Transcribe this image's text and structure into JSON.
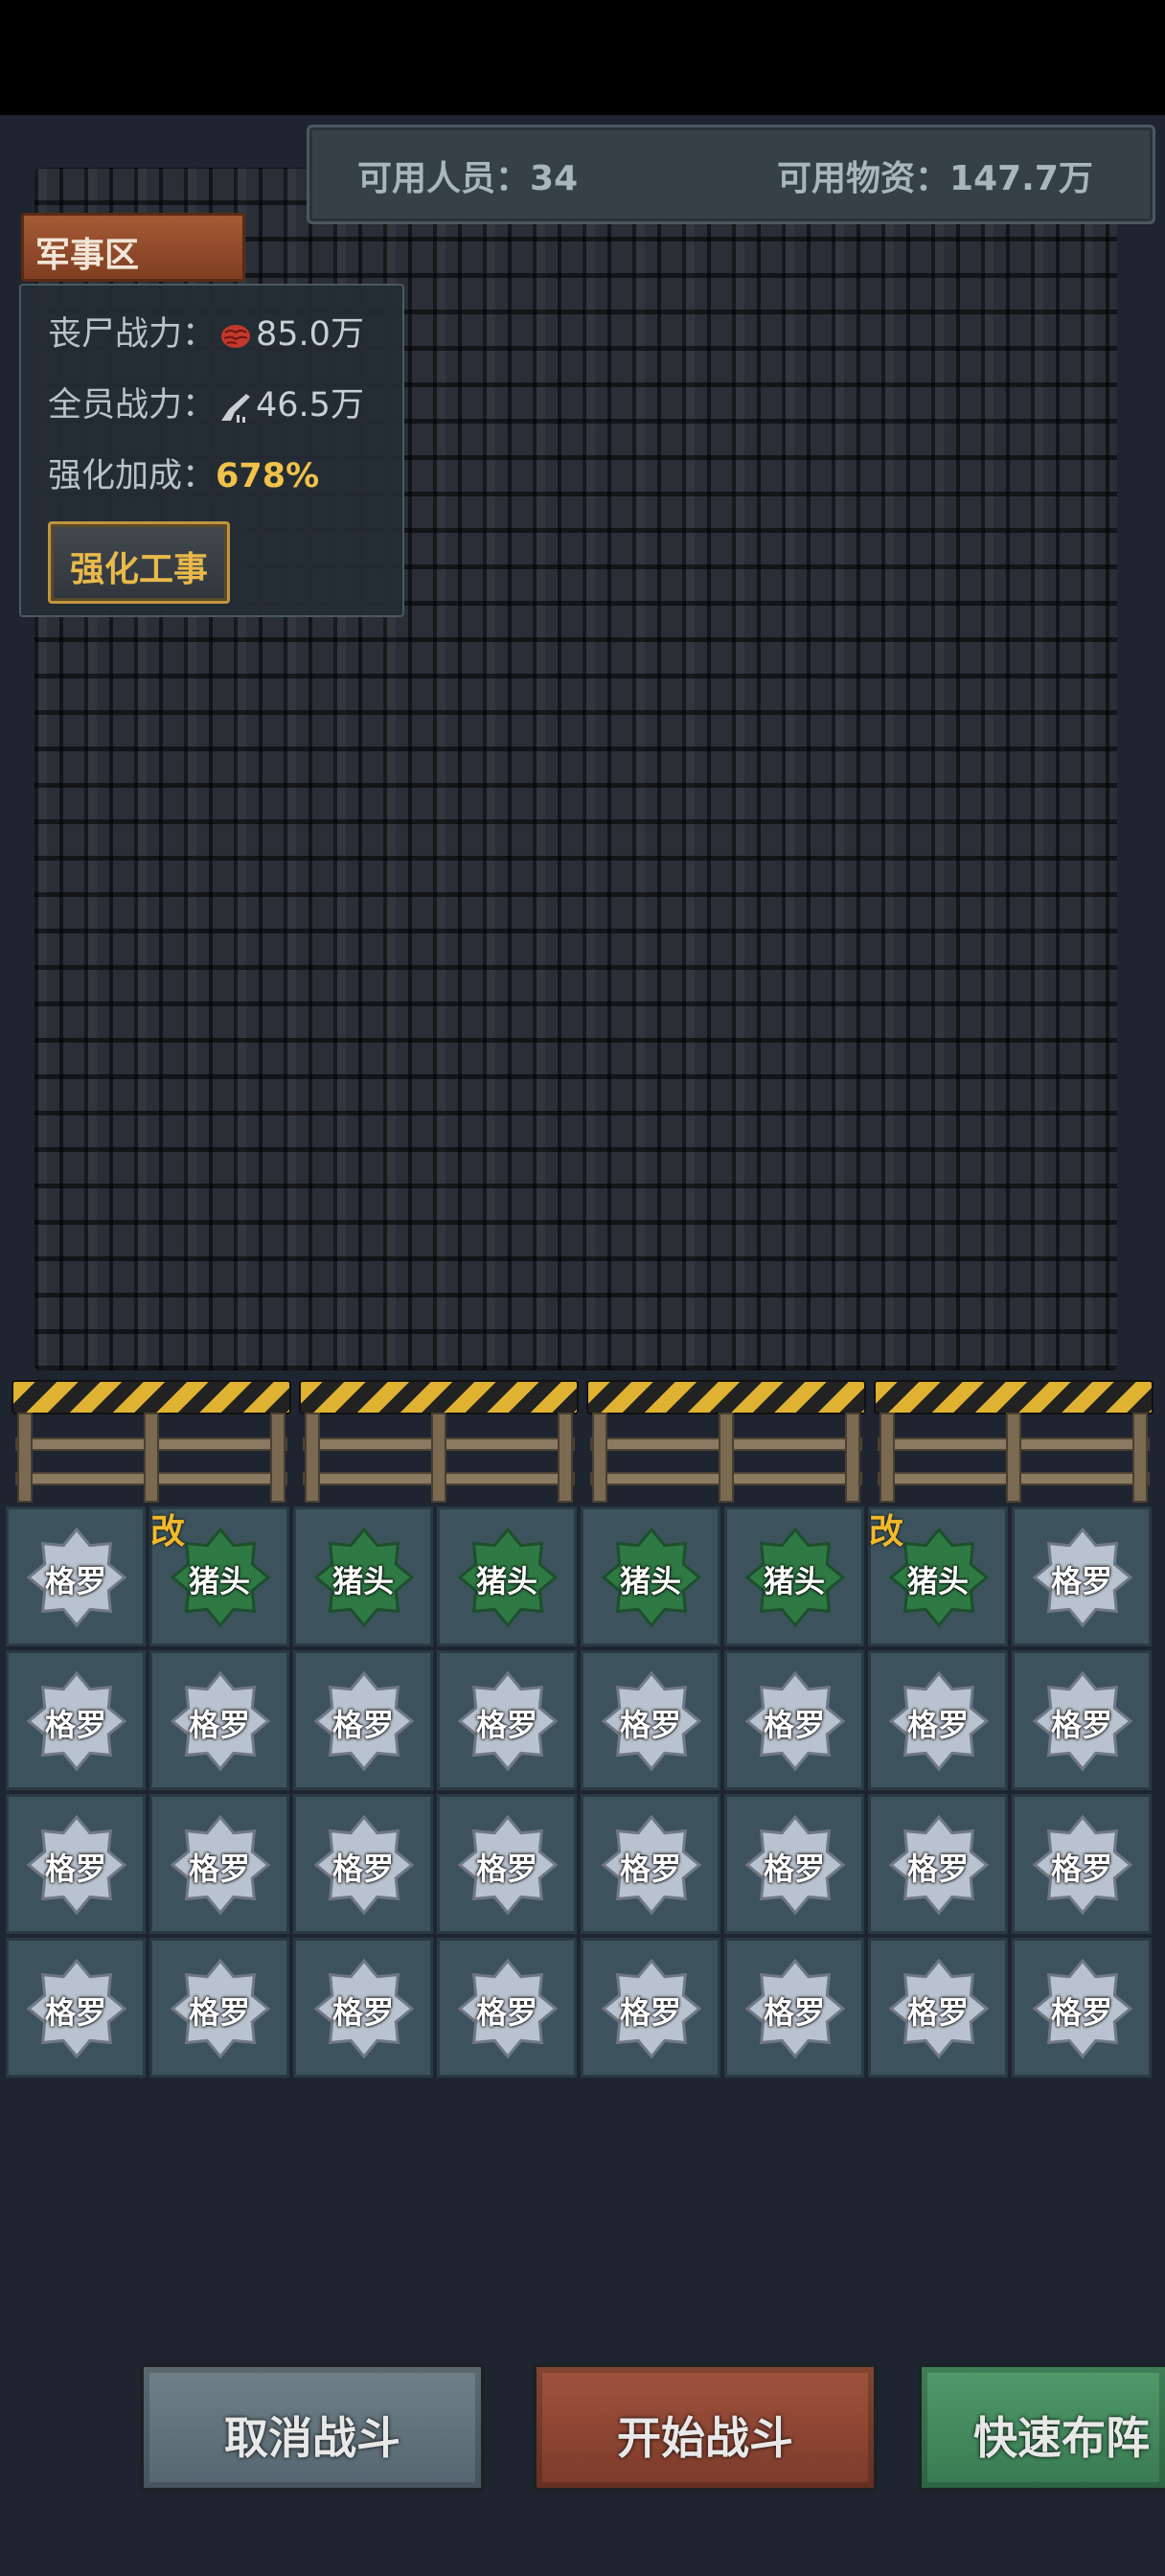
{
  "header": {
    "available_personnel_label": "可用人员：",
    "available_personnel_value": "34",
    "available_supplies_label": "可用物资：",
    "available_supplies_value": "147.7万"
  },
  "zone": {
    "title": "军事区",
    "zombie_power_label": "丧尸战力：",
    "zombie_power_icon": "brain-icon",
    "zombie_power_value": "85.0万",
    "total_power_label": "全员战力：",
    "total_power_icon": "rifle-icon",
    "total_power_value": "46.5万",
    "fortify_bonus_label": "强化加成：",
    "fortify_bonus_value": "678%",
    "fortify_button": "强化工事"
  },
  "colors": {
    "silver_badge": "#b9c3cf",
    "green_badge": "#2f7a44",
    "mod_marker": "#f2b92a"
  },
  "units": {
    "rows": [
      [
        {
          "name": "格罗",
          "tier": "silver",
          "mod": ""
        },
        {
          "name": "猪头",
          "tier": "green",
          "mod": "改"
        },
        {
          "name": "猪头",
          "tier": "green",
          "mod": ""
        },
        {
          "name": "猪头",
          "tier": "green",
          "mod": ""
        },
        {
          "name": "猪头",
          "tier": "green",
          "mod": ""
        },
        {
          "name": "猪头",
          "tier": "green",
          "mod": ""
        },
        {
          "name": "猪头",
          "tier": "green",
          "mod": "改"
        },
        {
          "name": "格罗",
          "tier": "silver",
          "mod": ""
        }
      ],
      [
        {
          "name": "格罗",
          "tier": "silver",
          "mod": ""
        },
        {
          "name": "格罗",
          "tier": "silver",
          "mod": ""
        },
        {
          "name": "格罗",
          "tier": "silver",
          "mod": ""
        },
        {
          "name": "格罗",
          "tier": "silver",
          "mod": ""
        },
        {
          "name": "格罗",
          "tier": "silver",
          "mod": ""
        },
        {
          "name": "格罗",
          "tier": "silver",
          "mod": ""
        },
        {
          "name": "格罗",
          "tier": "silver",
          "mod": ""
        },
        {
          "name": "格罗",
          "tier": "silver",
          "mod": ""
        }
      ],
      [
        {
          "name": "格罗",
          "tier": "silver",
          "mod": ""
        },
        {
          "name": "格罗",
          "tier": "silver",
          "mod": ""
        },
        {
          "name": "格罗",
          "tier": "silver",
          "mod": ""
        },
        {
          "name": "格罗",
          "tier": "silver",
          "mod": ""
        },
        {
          "name": "格罗",
          "tier": "silver",
          "mod": ""
        },
        {
          "name": "格罗",
          "tier": "silver",
          "mod": ""
        },
        {
          "name": "格罗",
          "tier": "silver",
          "mod": ""
        },
        {
          "name": "格罗",
          "tier": "silver",
          "mod": ""
        }
      ],
      [
        {
          "name": "格罗",
          "tier": "silver",
          "mod": ""
        },
        {
          "name": "格罗",
          "tier": "silver",
          "mod": ""
        },
        {
          "name": "格罗",
          "tier": "silver",
          "mod": ""
        },
        {
          "name": "格罗",
          "tier": "silver",
          "mod": ""
        },
        {
          "name": "格罗",
          "tier": "silver",
          "mod": ""
        },
        {
          "name": "格罗",
          "tier": "silver",
          "mod": ""
        },
        {
          "name": "格罗",
          "tier": "silver",
          "mod": ""
        },
        {
          "name": "格罗",
          "tier": "silver",
          "mod": ""
        }
      ]
    ]
  },
  "actions": {
    "cancel_battle": "取消战斗",
    "start_battle": "开始战斗",
    "quick_deploy": "快速布阵"
  }
}
